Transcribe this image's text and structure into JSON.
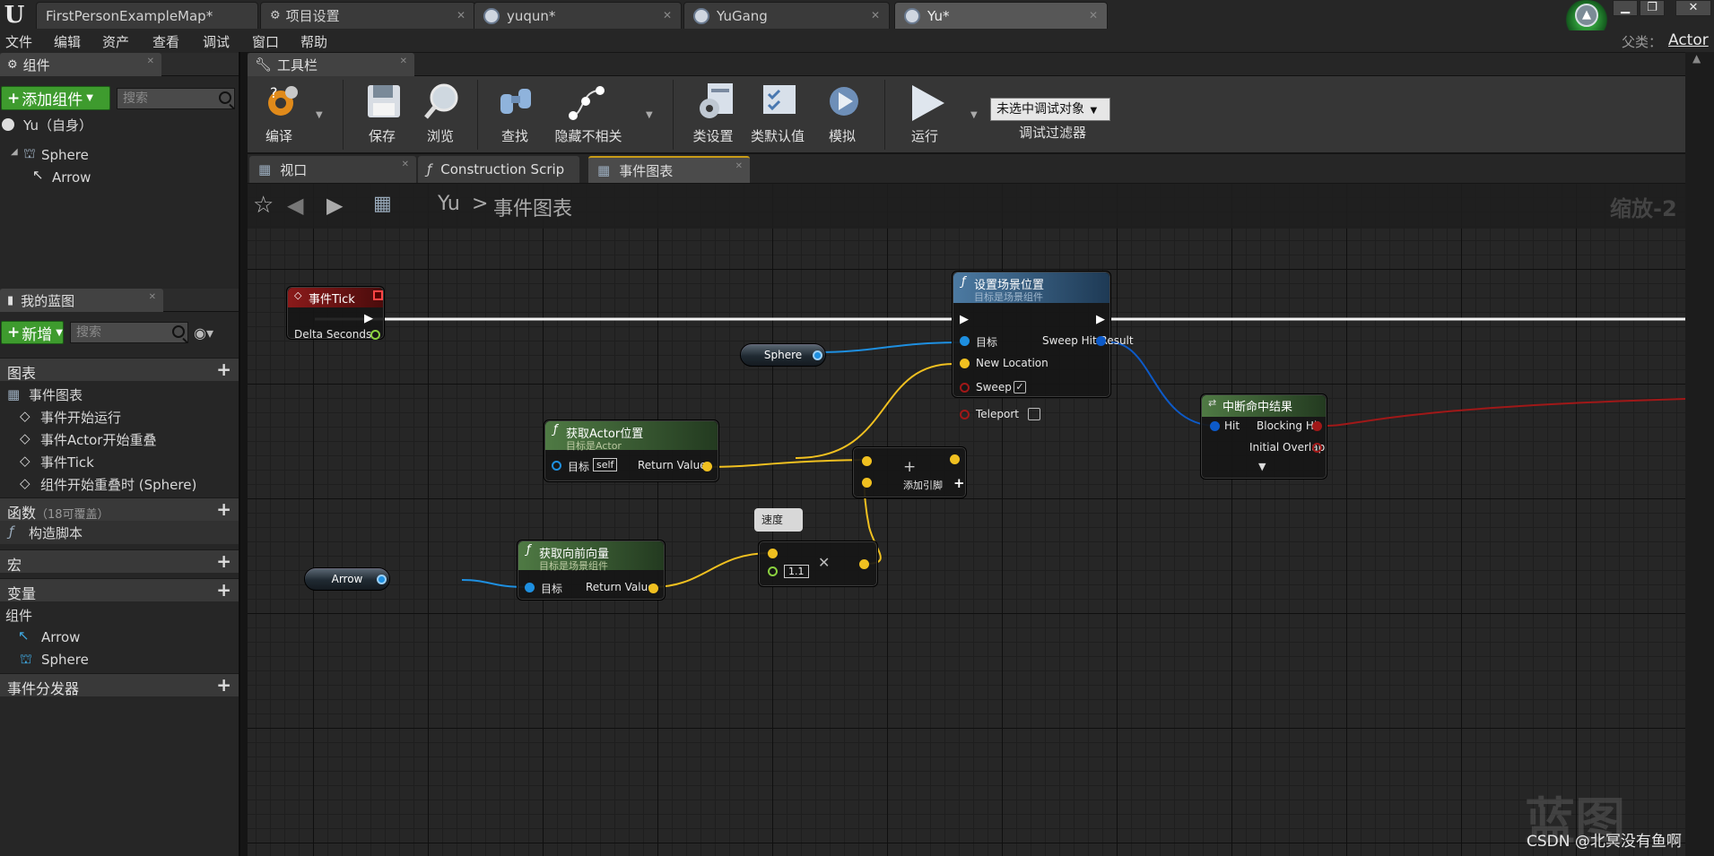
{
  "tabs": [
    {
      "label": "FirstPersonExampleMap*"
    },
    {
      "label": "项目设置"
    },
    {
      "label": "yuqun*"
    },
    {
      "label": "YuGang"
    },
    {
      "label": "Yu*"
    }
  ],
  "window": {
    "min": "▁",
    "restore": "❐",
    "close": "✕"
  },
  "menu": [
    "文件",
    "编辑",
    "资产",
    "查看",
    "调试",
    "窗口",
    "帮助"
  ],
  "parent": {
    "label": "父类：",
    "value": "Actor"
  },
  "components_panel": {
    "title": "组件",
    "add_button": "添加组件",
    "search_placeholder": "搜索",
    "root": "Yu（自身）",
    "items": [
      "Sphere",
      "Arrow"
    ]
  },
  "my_blueprint": {
    "title": "我的蓝图",
    "new_button": "新增",
    "search_placeholder": "搜索",
    "sections": {
      "graphs": "图表",
      "event_graph": "事件图表",
      "events": [
        "事件开始运行",
        "事件Actor开始重叠",
        "事件Tick",
        "组件开始重叠时 (Sphere)"
      ],
      "functions": "函数",
      "functions_sub": "（18可覆盖）",
      "construction": "构造脚本",
      "macros": "宏",
      "variables": "变量",
      "components": "组件",
      "component_vars": [
        "Arrow",
        "Sphere"
      ],
      "dispatchers": "事件分发器"
    }
  },
  "toolbar": {
    "title": "工具栏",
    "buttons": [
      "编译",
      "保存",
      "浏览",
      "查找",
      "隐藏不相关",
      "类设置",
      "类默认值",
      "模拟",
      "运行"
    ],
    "debug_object": "未选中调试对象",
    "debug_filter": "调试过滤器"
  },
  "graph_tabs": [
    "视口",
    "Construction Scrip",
    "事件图表"
  ],
  "breadcrumb": {
    "root": "Yu",
    "sep": ">",
    "current": "事件图表"
  },
  "zoom": "缩放-2",
  "nodes": {
    "tick": {
      "title": "事件Tick",
      "pin": "Delta Seconds"
    },
    "set_location": {
      "title": "设置场景位置",
      "subtitle": "目标是场景组件",
      "pins": [
        "目标",
        "New Location",
        "Sweep",
        "Teleport"
      ],
      "out_pin": "Sweep Hit Result"
    },
    "sphere_var": "Sphere",
    "arrow_var": "Arrow",
    "get_actor_location": {
      "title": "获取Actor位置",
      "subtitle": "目标是Actor",
      "target": "目标",
      "self_label": "self",
      "out_pin": "Return Value"
    },
    "get_forward": {
      "title": "获取向前向量",
      "subtitle": "目标是场景组件",
      "target": "目标",
      "out_pin": "Return Value"
    },
    "add": {
      "add_pin": "添加引脚"
    },
    "multiply": {
      "value": "1.1",
      "comment": "速度"
    },
    "break_hit": {
      "title": "中断命中结果",
      "pins": [
        "Hit"
      ],
      "out_pins": [
        "Blocking Hit",
        "Initial Overlap"
      ]
    }
  },
  "watermark": "蓝图",
  "credit": "CSDN @北冥没有鱼啊"
}
